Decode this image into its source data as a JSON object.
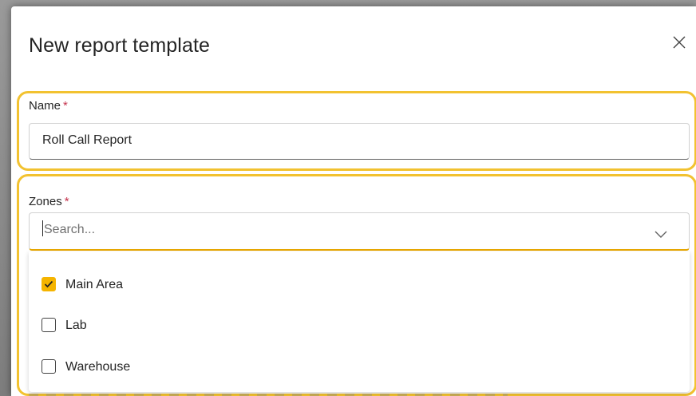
{
  "dialog": {
    "title": "New report template",
    "close_icon": "close-icon"
  },
  "name_field": {
    "label": "Name",
    "required_marker": "*",
    "value": "Roll Call Report"
  },
  "zones_field": {
    "label": "Zones",
    "required_marker": "*",
    "placeholder": "Search...",
    "chevron_icon": "chevron-down-icon",
    "options": [
      {
        "label": "Main Area",
        "checked": true
      },
      {
        "label": "Lab",
        "checked": false
      },
      {
        "label": "Warehouse",
        "checked": false
      }
    ]
  },
  "colors": {
    "accent": "#f5b400",
    "highlight": "#f2c230",
    "required": "#c4314b"
  }
}
